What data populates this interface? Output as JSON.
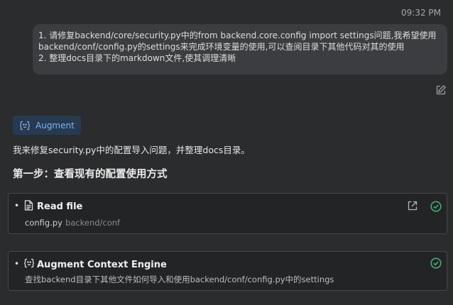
{
  "message": {
    "timestamp": "09:32 PM",
    "lines": [
      "1. 请修复backend/core/security.py中的from backend.core.config import settings问题,我希望使用",
      "backend/conf/config.py的settings来完成环境变量的使用,可以查阅目录下其他代码对其的使用",
      "2. 整理docs目录下的markdown文件,使其调理清晰"
    ]
  },
  "agent": {
    "name": "Augment",
    "intro": "我来修复security.py中的配置导入问题，并整理docs目录。",
    "step_heading": "第一步：查看现有的配置使用方式"
  },
  "tools": [
    {
      "bullet": "•",
      "title": "Read file",
      "file": "config.py",
      "path": "backend/conf",
      "icon": "document-icon",
      "status": "success"
    },
    {
      "bullet": "•",
      "title": "Augment Context Engine",
      "description": "查找backend目录下其他文件如何导入和使用backend/conf/config.py中的settings",
      "icon": "augment-icon",
      "status": "success"
    }
  ],
  "colors": {
    "background": "#2b2c2e",
    "bubble": "#3c3d40",
    "badge_bg": "#263a51",
    "badge_text": "#7fb4f0",
    "success": "#3fb873"
  }
}
